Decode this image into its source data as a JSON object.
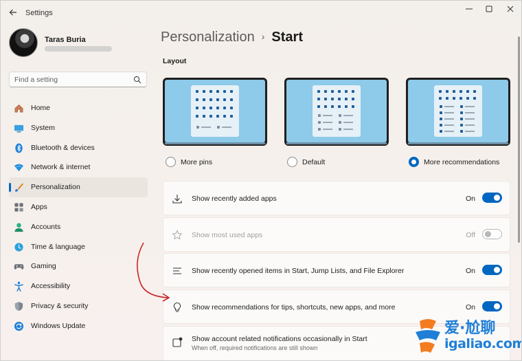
{
  "window": {
    "title": "Settings",
    "controls": [
      "minimize-icon",
      "maximize-icon",
      "close-icon"
    ]
  },
  "profile": {
    "name": "Taras Buria"
  },
  "search": {
    "placeholder": "Find a setting"
  },
  "sidebar": {
    "items": [
      {
        "label": "Home",
        "icon": "home-icon"
      },
      {
        "label": "System",
        "icon": "system-icon"
      },
      {
        "label": "Bluetooth & devices",
        "icon": "bluetooth-icon"
      },
      {
        "label": "Network & internet",
        "icon": "network-icon"
      },
      {
        "label": "Personalization",
        "icon": "personalization-icon",
        "active": true
      },
      {
        "label": "Apps",
        "icon": "apps-icon"
      },
      {
        "label": "Accounts",
        "icon": "accounts-icon"
      },
      {
        "label": "Time & language",
        "icon": "time-language-icon"
      },
      {
        "label": "Gaming",
        "icon": "gaming-icon"
      },
      {
        "label": "Accessibility",
        "icon": "accessibility-icon"
      },
      {
        "label": "Privacy & security",
        "icon": "privacy-icon"
      },
      {
        "label": "Windows Update",
        "icon": "windows-update-icon"
      }
    ]
  },
  "breadcrumb": {
    "parent": "Personalization",
    "separator": "›",
    "current": "Start"
  },
  "layout": {
    "title": "Layout",
    "options": [
      {
        "label": "More pins",
        "selected": false
      },
      {
        "label": "Default",
        "selected": false
      },
      {
        "label": "More recommendations",
        "selected": true
      }
    ]
  },
  "settings": [
    {
      "label": "Show recently added apps",
      "state": "On",
      "on": true,
      "enabled": true,
      "icon": "download-icon"
    },
    {
      "label": "Show most used apps",
      "state": "Off",
      "on": false,
      "enabled": false,
      "icon": "star-icon"
    },
    {
      "label": "Show recently opened items in Start, Jump Lists, and File Explorer",
      "state": "On",
      "on": true,
      "enabled": true,
      "icon": "list-icon"
    },
    {
      "label": "Show recommendations for tips, shortcuts, new apps, and more",
      "state": "On",
      "on": true,
      "enabled": true,
      "icon": "lightbulb-icon"
    },
    {
      "label": "Show account related notifications occasionally in Start",
      "sublabel": "When off, required notifications are still shown",
      "icon": "account-notification-icon"
    }
  ],
  "colors": {
    "accent": "#0067c0",
    "annotation": "#c62828",
    "watermark": "#1f7fd7"
  },
  "watermark": {
    "text_cn": "爱·尬聊",
    "url": "igaliao.com"
  }
}
